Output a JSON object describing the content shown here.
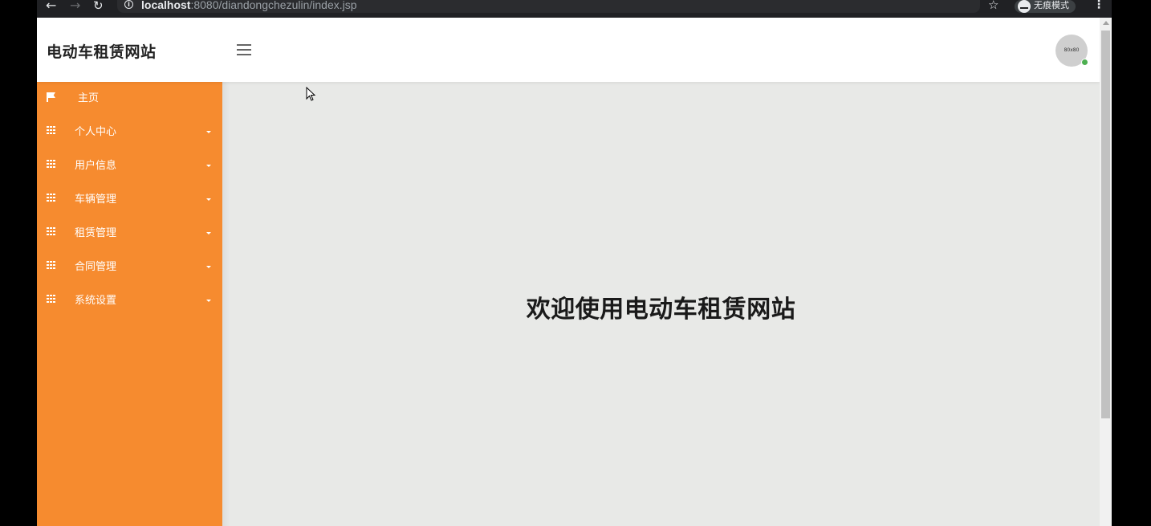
{
  "browser": {
    "url_host": "localhost",
    "url_path": ":8080/diandongchezulin/index.jsp",
    "incognito_label": "无痕模式",
    "icons": [
      "back-icon",
      "forward-icon",
      "reload-icon",
      "info-icon",
      "star-icon",
      "incognito-icon",
      "kebab-icon"
    ]
  },
  "header": {
    "brand": "电动车租赁网站",
    "avatar_text": "80x80"
  },
  "sidebar": {
    "items": [
      {
        "label": "主页",
        "icon": "flag-icon",
        "has_submenu": false
      },
      {
        "label": "个人中心",
        "icon": "grid-icon",
        "has_submenu": true
      },
      {
        "label": "用户信息",
        "icon": "grid-icon",
        "has_submenu": true
      },
      {
        "label": "车辆管理",
        "icon": "grid-icon",
        "has_submenu": true
      },
      {
        "label": "租赁管理",
        "icon": "grid-icon",
        "has_submenu": true
      },
      {
        "label": "合同管理",
        "icon": "grid-icon",
        "has_submenu": true
      },
      {
        "label": "系统设置",
        "icon": "grid-icon",
        "has_submenu": true
      }
    ]
  },
  "main": {
    "welcome_text": "欢迎使用电动车租赁网站"
  },
  "colors": {
    "sidebar_bg": "#f68b2f",
    "content_bg": "#e8e9e7",
    "header_bg": "#ffffff",
    "online_status": "#4caf50"
  }
}
